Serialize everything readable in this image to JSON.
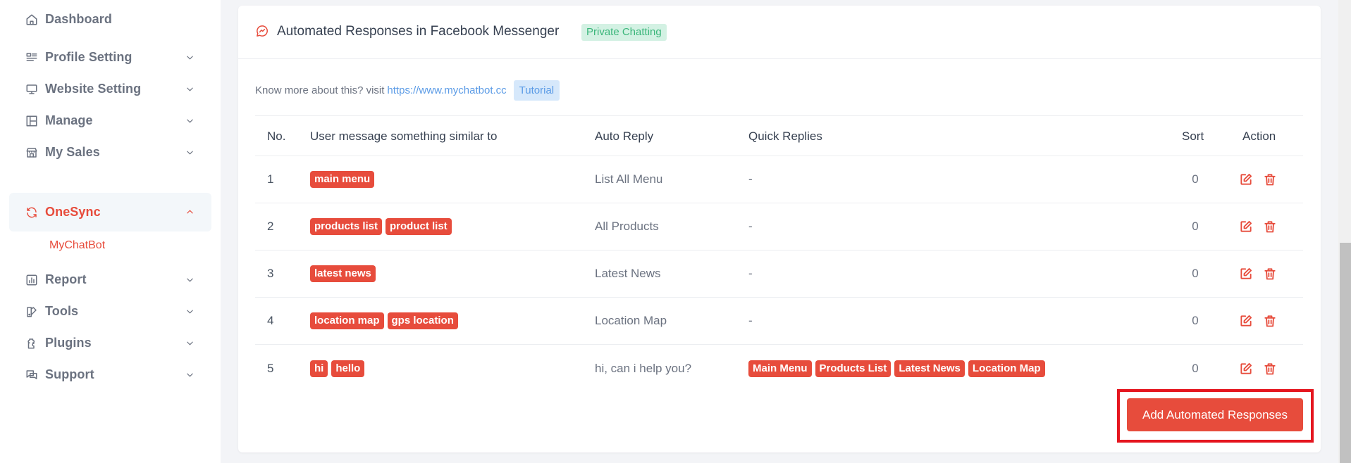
{
  "sidebar": {
    "items": [
      {
        "label": "Dashboard",
        "icon": "home-icon",
        "has_chevron": false
      },
      {
        "label": "Profile Setting",
        "icon": "profile-list-icon",
        "has_chevron": true
      },
      {
        "label": "Website Setting",
        "icon": "monitor-icon",
        "has_chevron": true
      },
      {
        "label": "Manage",
        "icon": "layout-icon",
        "has_chevron": true
      },
      {
        "label": "My Sales",
        "icon": "store-icon",
        "has_chevron": true
      },
      {
        "label": "OneSync",
        "icon": "sync-icon",
        "has_chevron": true,
        "active": true,
        "expanded": true
      },
      {
        "label": "Report",
        "icon": "chart-icon",
        "has_chevron": true
      },
      {
        "label": "Tools",
        "icon": "tools-icon",
        "has_chevron": true
      },
      {
        "label": "Plugins",
        "icon": "plugin-icon",
        "has_chevron": true
      },
      {
        "label": "Support",
        "icon": "chat-icon",
        "has_chevron": true
      }
    ],
    "sub_items": [
      {
        "label": "MyChatBot",
        "active": true
      }
    ]
  },
  "card": {
    "title": "Automated Responses in Facebook Messenger",
    "badge": "Private Chatting",
    "info_text": "Know more about this? visit",
    "info_link": "https://www.mychatbot.cc",
    "tutorial_label": "Tutorial"
  },
  "table": {
    "headers": {
      "no": "No.",
      "message": "User message something similar to",
      "auto_reply": "Auto Reply",
      "quick_replies": "Quick Replies",
      "sort": "Sort",
      "action": "Action"
    },
    "rows": [
      {
        "no": "1",
        "keywords": [
          "main menu"
        ],
        "auto_reply": "List All Menu",
        "quick_replies": [],
        "quick_replies_empty": "-",
        "sort": "0"
      },
      {
        "no": "2",
        "keywords": [
          "products list",
          "product list"
        ],
        "auto_reply": "All Products",
        "quick_replies": [],
        "quick_replies_empty": "-",
        "sort": "0"
      },
      {
        "no": "3",
        "keywords": [
          "latest news"
        ],
        "auto_reply": "Latest News",
        "quick_replies": [],
        "quick_replies_empty": "-",
        "sort": "0"
      },
      {
        "no": "4",
        "keywords": [
          "location map",
          "gps location"
        ],
        "auto_reply": "Location Map",
        "quick_replies": [],
        "quick_replies_empty": "-",
        "sort": "0"
      },
      {
        "no": "5",
        "keywords": [
          "hi",
          "hello"
        ],
        "auto_reply": "hi, can i help you?",
        "quick_replies": [
          "Main Menu",
          "Products List",
          "Latest News",
          "Location Map"
        ],
        "quick_replies_empty": "",
        "sort": "0"
      }
    ]
  },
  "add_button_label": "Add Automated Responses",
  "colors": {
    "accent": "#e74c3c",
    "highlight": "#e5161f",
    "success_badge_bg": "#d3f1e3",
    "success_badge_text": "#3ab67a",
    "info_badge_bg": "#d6e8fb",
    "link": "#5b9be6"
  }
}
